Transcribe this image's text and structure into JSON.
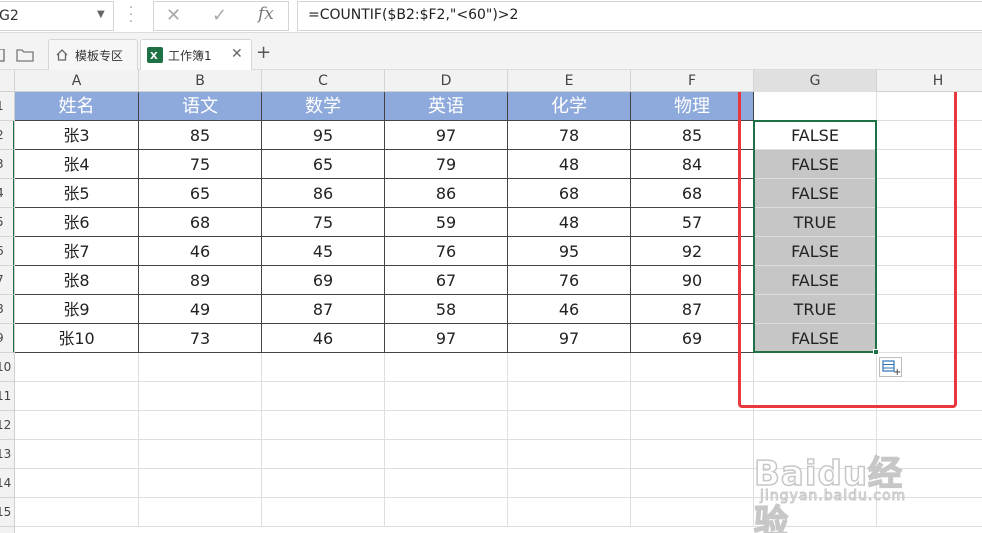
{
  "formula_bar": {
    "name_box": "G2",
    "cancel_icon": "close-icon",
    "confirm_icon": "check-icon",
    "fx_label": "fx",
    "formula": "=COUNTIF($B2:$F2,\"<60\")>2"
  },
  "tabs": [
    {
      "label": "模板专区",
      "icon": "home-icon"
    },
    {
      "label": "工作簿1",
      "icon": "excel-icon"
    }
  ],
  "columns": [
    "A",
    "B",
    "C",
    "D",
    "E",
    "F",
    "G",
    "H"
  ],
  "rows": [
    "1",
    "2",
    "3",
    "4",
    "5",
    "6",
    "7",
    "8",
    "9",
    "10",
    "11",
    "12",
    "13",
    "14",
    "15"
  ],
  "table": {
    "headers": [
      "姓名",
      "语文",
      "数学",
      "英语",
      "化学",
      "物理"
    ],
    "rows": [
      [
        "张3",
        "85",
        "95",
        "97",
        "78",
        "85"
      ],
      [
        "张4",
        "75",
        "65",
        "79",
        "48",
        "84"
      ],
      [
        "张5",
        "65",
        "86",
        "86",
        "68",
        "68"
      ],
      [
        "张6",
        "68",
        "75",
        "59",
        "48",
        "57"
      ],
      [
        "张7",
        "46",
        "45",
        "76",
        "95",
        "92"
      ],
      [
        "张8",
        "89",
        "69",
        "67",
        "76",
        "90"
      ],
      [
        "张9",
        "49",
        "87",
        "58",
        "46",
        "87"
      ],
      [
        "张10",
        "73",
        "46",
        "97",
        "97",
        "69"
      ]
    ],
    "results": [
      "FALSE",
      "FALSE",
      "FALSE",
      "TRUE",
      "FALSE",
      "FALSE",
      "TRUE",
      "FALSE"
    ]
  },
  "colors": {
    "header_fill": "#8ea9db",
    "selection_fill": "#c6c6c6",
    "selection_border": "#1e7145",
    "highlight_box": "#e8383d"
  },
  "watermark": {
    "logo": "Baidu经验",
    "url": "jingyan.baidu.com"
  }
}
